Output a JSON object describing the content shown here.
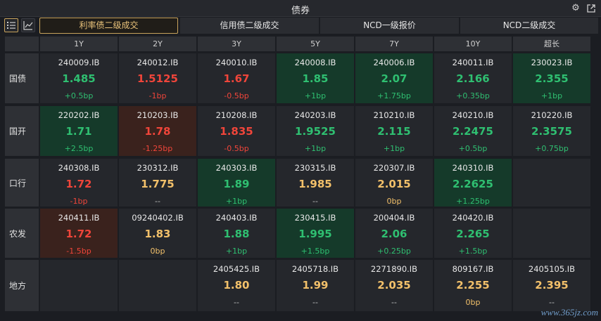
{
  "window": {
    "title": "债券",
    "settings_icon": "gear-icon",
    "popout_icon": "external-link-icon"
  },
  "toolbar": {
    "list_view_icon": "list-icon",
    "chart_view_icon": "line-chart-icon",
    "tabs": [
      "利率债二级成交",
      "信用债二级成交",
      "NCD一级报价",
      "NCD二级成交"
    ],
    "active_tab": 0
  },
  "columns": [
    "1Y",
    "2Y",
    "3Y",
    "5Y",
    "7Y",
    "10Y",
    "超长"
  ],
  "rows": [
    {
      "name": "国债",
      "cells": [
        {
          "code": "240009.IB",
          "yield": "1.485",
          "change": "+0.5bp",
          "color": "g",
          "bg": ""
        },
        {
          "code": "240012.IB",
          "yield": "1.5125",
          "change": "-1bp",
          "color": "r",
          "bg": ""
        },
        {
          "code": "240010.IB",
          "yield": "1.67",
          "change": "-0.5bp",
          "color": "r",
          "bg": ""
        },
        {
          "code": "240008.IB",
          "yield": "1.85",
          "change": "+1bp",
          "color": "g",
          "bg": "up"
        },
        {
          "code": "240006.IB",
          "yield": "2.07",
          "change": "+1.75bp",
          "color": "g",
          "bg": "up"
        },
        {
          "code": "240011.IB",
          "yield": "2.166",
          "change": "+0.35bp",
          "color": "g",
          "bg": ""
        },
        {
          "code": "230023.IB",
          "yield": "2.355",
          "change": "+1bp",
          "color": "g",
          "bg": "up"
        }
      ]
    },
    {
      "name": "国开",
      "cells": [
        {
          "code": "220202.IB",
          "yield": "1.71",
          "change": "+2.5bp",
          "color": "g",
          "bg": "up"
        },
        {
          "code": "210203.IB",
          "yield": "1.78",
          "change": "-1.25bp",
          "color": "r",
          "bg": "down"
        },
        {
          "code": "210208.IB",
          "yield": "1.835",
          "change": "-0.5bp",
          "color": "r",
          "bg": ""
        },
        {
          "code": "240203.IB",
          "yield": "1.9525",
          "change": "+1bp",
          "color": "g",
          "bg": ""
        },
        {
          "code": "210210.IB",
          "yield": "2.115",
          "change": "+1bp",
          "color": "g",
          "bg": ""
        },
        {
          "code": "240210.IB",
          "yield": "2.2475",
          "change": "+0.5bp",
          "color": "g",
          "bg": ""
        },
        {
          "code": "210220.IB",
          "yield": "2.3575",
          "change": "+0.75bp",
          "color": "g",
          "bg": ""
        }
      ]
    },
    {
      "name": "口行",
      "cells": [
        {
          "code": "240308.IB",
          "yield": "1.72",
          "change": "-1bp",
          "color": "r",
          "bg": ""
        },
        {
          "code": "230312.IB",
          "yield": "1.775",
          "change": "--",
          "color": "y",
          "bg": ""
        },
        {
          "code": "240303.IB",
          "yield": "1.89",
          "change": "+1bp",
          "color": "g",
          "bg": "up"
        },
        {
          "code": "230315.IB",
          "yield": "1.985",
          "change": "--",
          "color": "y",
          "bg": ""
        },
        {
          "code": "220307.IB",
          "yield": "2.015",
          "change": "0bp",
          "color": "y",
          "bg": ""
        },
        {
          "code": "240310.IB",
          "yield": "2.2625",
          "change": "+1.25bp",
          "color": "g",
          "bg": "up"
        },
        {
          "code": "",
          "yield": "",
          "change": "",
          "color": "n",
          "bg": ""
        }
      ]
    },
    {
      "name": "农发",
      "cells": [
        {
          "code": "240411.IB",
          "yield": "1.72",
          "change": "-1.5bp",
          "color": "r",
          "bg": "down"
        },
        {
          "code": "09240402.IB",
          "yield": "1.83",
          "change": "0bp",
          "color": "y",
          "bg": ""
        },
        {
          "code": "240403.IB",
          "yield": "1.88",
          "change": "+1bp",
          "color": "g",
          "bg": ""
        },
        {
          "code": "230415.IB",
          "yield": "1.995",
          "change": "+1.5bp",
          "color": "g",
          "bg": "up"
        },
        {
          "code": "200404.IB",
          "yield": "2.06",
          "change": "+0.25bp",
          "color": "g",
          "bg": ""
        },
        {
          "code": "240420.IB",
          "yield": "2.265",
          "change": "+1.5bp",
          "color": "g",
          "bg": ""
        },
        {
          "code": "",
          "yield": "",
          "change": "",
          "color": "n",
          "bg": ""
        }
      ]
    },
    {
      "name": "地方",
      "cells": [
        {
          "code": "",
          "yield": "",
          "change": "",
          "color": "n",
          "bg": ""
        },
        {
          "code": "",
          "yield": "",
          "change": "",
          "color": "n",
          "bg": ""
        },
        {
          "code": "2405425.IB",
          "yield": "1.80",
          "change": "--",
          "color": "y",
          "bg": ""
        },
        {
          "code": "2405718.IB",
          "yield": "1.99",
          "change": "--",
          "color": "y",
          "bg": ""
        },
        {
          "code": "2271890.IB",
          "yield": "2.035",
          "change": "--",
          "color": "y",
          "bg": ""
        },
        {
          "code": "809167.IB",
          "yield": "2.255",
          "change": "0bp",
          "color": "y",
          "bg": ""
        },
        {
          "code": "2405105.IB",
          "yield": "2.395",
          "change": "--",
          "color": "y",
          "bg": ""
        }
      ]
    }
  ],
  "watermark": "www.365jz.com"
}
